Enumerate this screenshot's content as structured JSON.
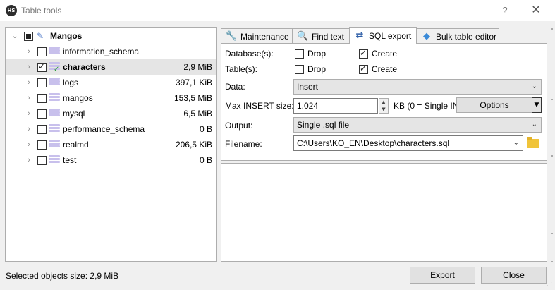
{
  "window": {
    "icon_text": "HS",
    "title": "Table tools",
    "help": "?",
    "close": "✕"
  },
  "tree": {
    "root": {
      "label": "Mangos",
      "state": "partial"
    },
    "items": [
      {
        "label": "information_schema",
        "size": "",
        "checked": false
      },
      {
        "label": "characters",
        "size": "2,9 MiB",
        "checked": true,
        "selected": true
      },
      {
        "label": "logs",
        "size": "397,1 KiB",
        "checked": false
      },
      {
        "label": "mangos",
        "size": "153,5 MiB",
        "checked": false
      },
      {
        "label": "mysql",
        "size": "6,5 MiB",
        "checked": false
      },
      {
        "label": "performance_schema",
        "size": "0 B",
        "checked": false
      },
      {
        "label": "realmd",
        "size": "206,5 KiB",
        "checked": false
      },
      {
        "label": "test",
        "size": "0 B",
        "checked": false
      }
    ]
  },
  "tabs": [
    {
      "label": "Maintenance",
      "icon": "wrench-icon"
    },
    {
      "label": "Find text",
      "icon": "magnifier-icon"
    },
    {
      "label": "SQL export",
      "icon": "export-arrows-icon",
      "active": true
    },
    {
      "label": "Bulk table editor",
      "icon": "layers-icon"
    }
  ],
  "sql_export": {
    "database_label": "Database(s):",
    "table_label": "Table(s):",
    "drop_label": "Drop",
    "create_label": "Create",
    "database_drop": false,
    "database_create": true,
    "table_drop": false,
    "table_create": true,
    "data_label": "Data:",
    "data_value": "Insert",
    "max_insert_label": "Max INSERT size:",
    "max_insert_value": "1.024",
    "max_insert_hint": "KB (0 = Single IN",
    "options_label": "Options",
    "output_label": "Output:",
    "output_value": "Single .sql file",
    "filename_label": "Filename:",
    "filename_value": "C:\\Users\\KO_EN\\Desktop\\characters.sql"
  },
  "footer": {
    "status": "Selected objects size: 2,9 MiB",
    "export_label": "Export",
    "close_label": "Close"
  }
}
